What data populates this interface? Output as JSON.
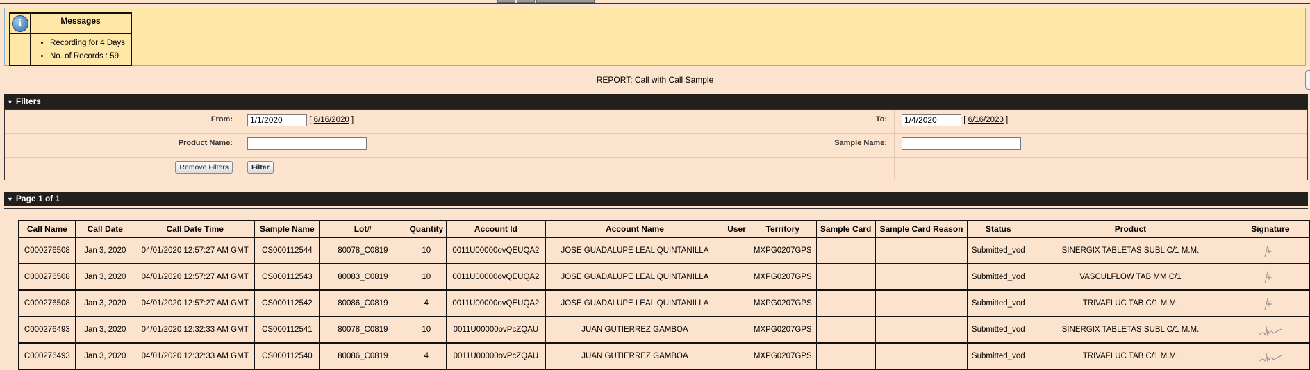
{
  "messages": {
    "title": "Messages",
    "items": [
      "Recording for 4 Days",
      "No. of Records : 59"
    ]
  },
  "report_title": "REPORT: Call with Call Sample",
  "filters": {
    "header": "Filters",
    "from_label": "From:",
    "from_value": "1/1/2020",
    "from_link": "6/16/2020",
    "to_label": "To:",
    "to_value": "1/4/2020",
    "to_link": "6/16/2020",
    "product_label": "Product Name:",
    "product_value": "",
    "sample_label": "Sample Name:",
    "sample_value": "",
    "remove_button": "Remove Filters",
    "filter_button": "Filter",
    "bracket_open": "[",
    "bracket_close": "]"
  },
  "page": {
    "header": "Page 1 of 1"
  },
  "table": {
    "columns": [
      "Call Name",
      "Call Date",
      "Call Date Time",
      "Sample Name",
      "Lot#",
      "Quantity",
      "Account Id",
      "Account Name",
      "User",
      "Territory",
      "Sample Card",
      "Sample Card Reason",
      "Status",
      "Product",
      "Signature"
    ],
    "rows": [
      [
        "C000276508",
        "Jan 3, 2020",
        "04/01/2020 12:57:27 AM GMT",
        "CS000112544",
        "80078_C0819",
        "10",
        "0011U00000ovQEUQA2",
        "JOSE GUADALUPE LEAL QUINTANILLA",
        "",
        "MXPG0207GPS",
        "",
        "",
        "Submitted_vod",
        "SINERGIX TABLETAS SUBL C/1 M.M.",
        "sig-a"
      ],
      [
        "C000276508",
        "Jan 3, 2020",
        "04/01/2020 12:57:27 AM GMT",
        "CS000112543",
        "80083_C0819",
        "10",
        "0011U00000ovQEUQA2",
        "JOSE GUADALUPE LEAL QUINTANILLA",
        "",
        "MXPG0207GPS",
        "",
        "",
        "Submitted_vod",
        "VASCULFLOW TAB MM C/1",
        "sig-a"
      ],
      [
        "C000276508",
        "Jan 3, 2020",
        "04/01/2020 12:57:27 AM GMT",
        "CS000112542",
        "80086_C0819",
        "4",
        "0011U00000ovQEUQA2",
        "JOSE GUADALUPE LEAL QUINTANILLA",
        "",
        "MXPG0207GPS",
        "",
        "",
        "Submitted_vod",
        "TRIVAFLUC TAB C/1 M.M.",
        "sig-a"
      ],
      [
        "C000276493",
        "Jan 3, 2020",
        "04/01/2020 12:32:33 AM GMT",
        "CS000112541",
        "80078_C0819",
        "10",
        "0011U00000ovPcZQAU",
        "JUAN GUTIERREZ GAMBOA",
        "",
        "MXPG0207GPS",
        "",
        "",
        "Submitted_vod",
        "SINERGIX TABLETAS SUBL C/1 M.M.",
        "sig-b"
      ],
      [
        "C000276493",
        "Jan 3, 2020",
        "04/01/2020 12:32:33 AM GMT",
        "CS000112540",
        "80086_C0819",
        "4",
        "0011U00000ovPcZQAU",
        "JUAN GUTIERREZ GAMBOA",
        "",
        "MXPG0207GPS",
        "",
        "",
        "Submitted_vod",
        "TRIVAFLUC TAB C/1 M.M.",
        "sig-b"
      ]
    ]
  },
  "colors": {
    "page_bg": "#fbe3cd",
    "message_bg": "#ffe7a8",
    "section_header_bg": "#231f1d",
    "message_border": "#7fb1d8"
  }
}
